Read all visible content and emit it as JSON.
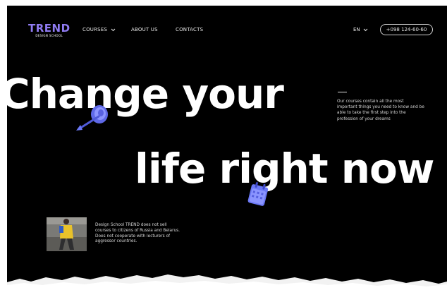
{
  "brand": {
    "name": "TREND",
    "subtitle": "DESIGN SCHOOL"
  },
  "nav": {
    "courses": "COURSES",
    "about": "ABOUT US",
    "contacts": "CONTACTS"
  },
  "language": {
    "current": "EN"
  },
  "phone": "+098 124-60-60",
  "hero": {
    "line1": "Change your",
    "line2": "life right now",
    "description": "Our courses contain all the most important things you need to know and be able to take the first step into the profession of your dreams"
  },
  "notice": "Design School TREND does not sell courses to citizens of Russia and Belarus. Does not cooperate with lecturers of aggressor countries.",
  "colors": {
    "background": "#000000",
    "accent": "#8f7bf1",
    "text": "#ffffff",
    "icon_blue": "#6b78f5"
  },
  "icons": [
    "chevron-down-icon",
    "dart-target-icon",
    "calendar-icon"
  ]
}
